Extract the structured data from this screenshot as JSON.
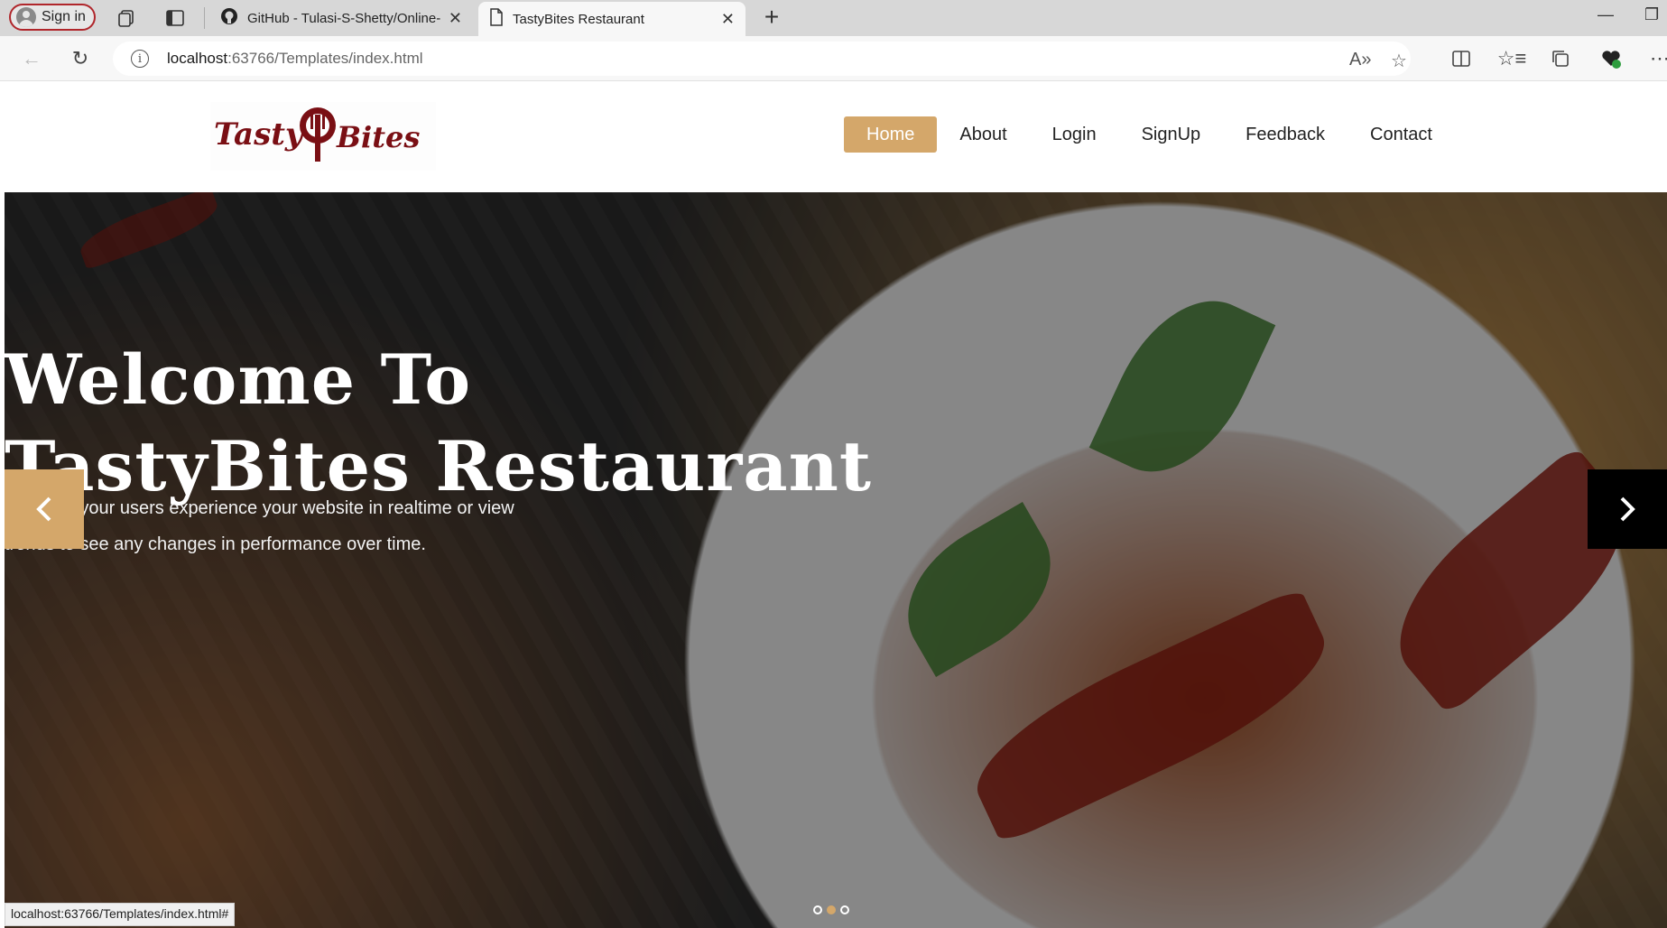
{
  "browser": {
    "profile_label": "Sign in",
    "tabs": [
      {
        "title": "GitHub - Tulasi-S-Shetty/Online-",
        "icon": "github-icon"
      },
      {
        "title": "TastyBites Restaurant",
        "icon": "page-icon"
      }
    ],
    "url_host": "localhost",
    "url_rest": ":63766/Templates/index.html",
    "status_url": "localhost:63766/Templates/index.html#"
  },
  "site": {
    "logo_word1": "Tasty",
    "logo_word2": "Bites",
    "nav": [
      "Home",
      "About",
      "Login",
      "SignUp",
      "Feedback",
      "Contact"
    ],
    "active_nav": "Home",
    "hero": {
      "title_line1": "Welcome To",
      "title_line2": "TastyBites Restaurant",
      "sub_line1": "See how your users experience your website in realtime or view",
      "sub_line2": "trends to see any changes in performance over time.",
      "slide_count": 3,
      "active_slide": 2
    }
  },
  "colors": {
    "accent": "#d4a76a",
    "logo": "#7a0f14",
    "profile_border": "#b0262b"
  }
}
